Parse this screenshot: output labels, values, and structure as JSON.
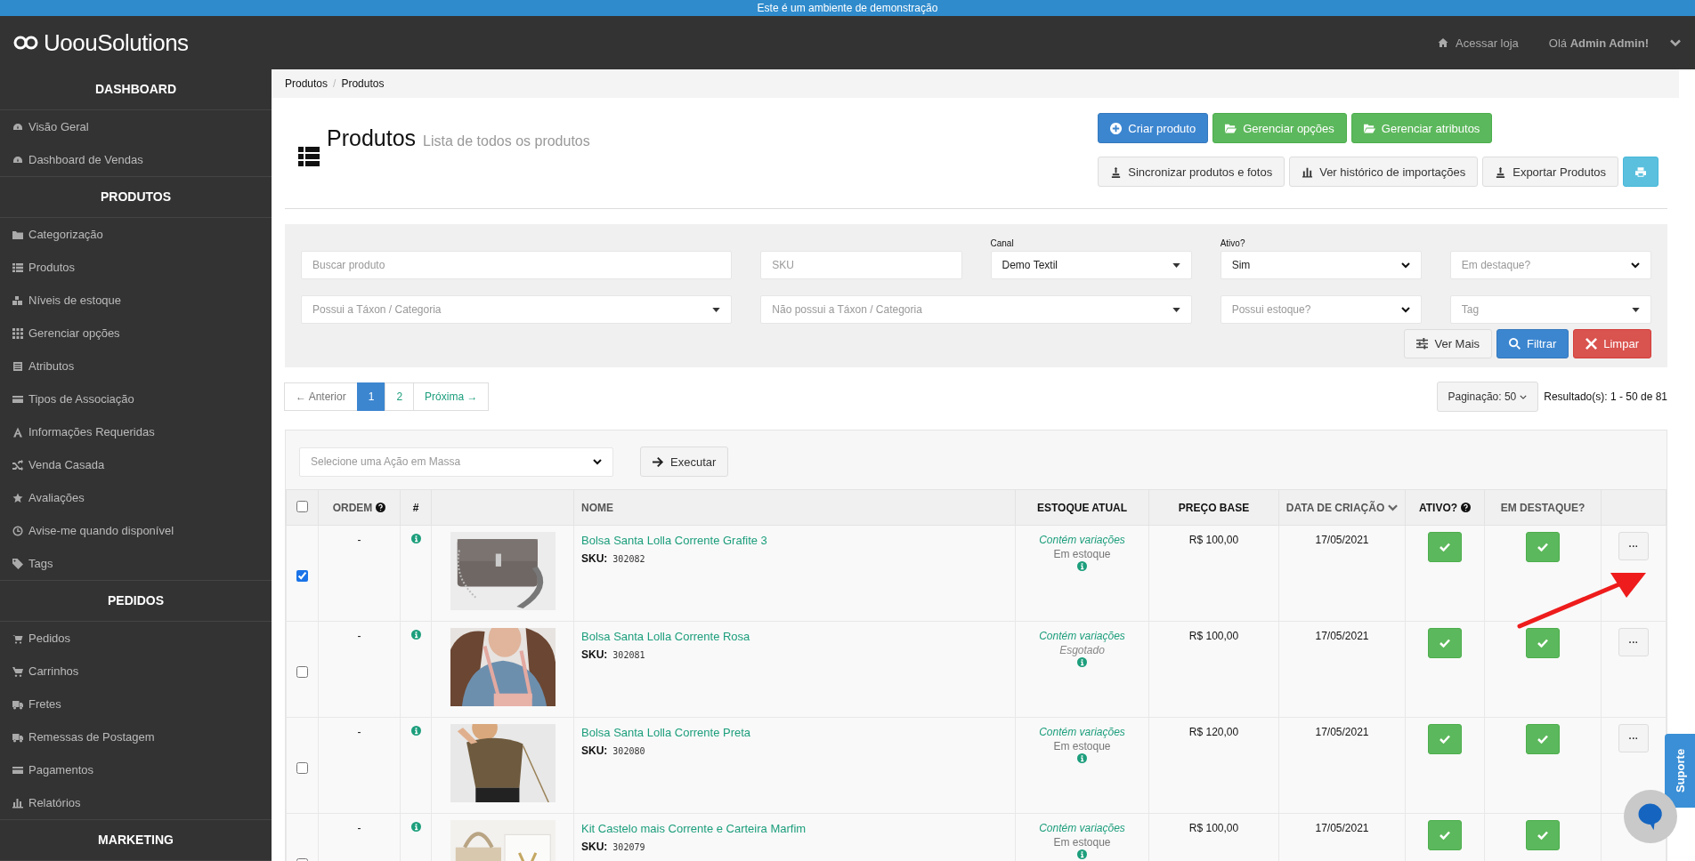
{
  "banner": "Este é um ambiente de demonstração",
  "header": {
    "brand": "**Uoou**Solutions",
    "store_link": "Acessar loja",
    "greeting": "Olá **Admin Admin!**"
  },
  "sidebar": [
    {
      "title": "DASHBOARD",
      "items": [
        "Visão Geral",
        "Dashboard de Vendas"
      ]
    },
    {
      "title": "PRODUTOS",
      "items": [
        "Categorização",
        "Produtos",
        "Níveis de estoque",
        "Gerenciar opções",
        "Atributos",
        "Tipos de Associação",
        "Informações Requeridas",
        "Venda Casada",
        "Avaliações",
        "Avise-me quando disponível",
        "Tags"
      ]
    },
    {
      "title": "PEDIDOS",
      "items": [
        "Pedidos",
        "Carrinhos",
        "Fretes",
        "Remessas de Postagem",
        "Pagamentos",
        "Relatórios"
      ]
    },
    {
      "title": "MARKETING"
    }
  ],
  "breadcrumb": {
    "items": [
      "Produtos",
      "Produtos"
    ],
    "separator": "/"
  },
  "page": {
    "title": "Produtos",
    "subtitle": "Lista de todos os produtos"
  },
  "buttons": [
    [
      {
        "kind": "primary",
        "label": "Criar produto"
      },
      {
        "kind": "success",
        "label": "Gerenciar opções"
      },
      {
        "kind": "success",
        "label": "Gerenciar atributos"
      }
    ],
    [
      {
        "kind": "default",
        "label": "Sincronizar produtos e fotos"
      },
      {
        "kind": "default",
        "label": "Ver histórico de importações"
      },
      {
        "kind": "default",
        "label": "Exportar Produtos"
      },
      {
        "kind": "info"
      }
    ]
  ],
  "filters": [
    [
      {
        "kind": "text",
        "placeholder": "Buscar produto"
      },
      {
        "kind": "text",
        "placeholder": "SKU"
      },
      {
        "kind": "select2",
        "label": "Canal",
        "value": "Demo Textil"
      },
      {
        "kind": "select",
        "label": "Ativo?",
        "value": "Sim"
      },
      {
        "kind": "select",
        "placeholder": "Em destaque?"
      }
    ],
    [
      {
        "kind": "select2",
        "placeholder": "Possui a Táxon / Categoria"
      },
      {
        "kind": "select2",
        "placeholder": "Não possui a Táxon / Categoria"
      },
      {
        "kind": "select",
        "placeholder": "Possui estoque?"
      },
      {
        "kind": "select2",
        "placeholder": "Tag"
      }
    ]
  ],
  "filter_buttons": [
    {
      "kind": "default",
      "label": "Ver Mais"
    },
    {
      "kind": "primary",
      "label": "Filtrar"
    },
    {
      "kind": "danger",
      "label": "Limpar"
    }
  ],
  "pagination": {
    "prev": "← Anterior",
    "next": "Próxima →",
    "pages": [
      {
        "label": "1",
        "selected": true
      },
      {
        "label": "2",
        "selected": false
      }
    ],
    "page_size": "Paginação: 50",
    "results": "Resultado(s): 1 - 50 de 81"
  },
  "bulk": {
    "placeholder": "Selecione uma Ação em Massa",
    "button": "Executar"
  },
  "table": {
    "select_all": {
      "checked": false
    },
    "columns": [
      {
        "label": "ORDEM",
        "sortable": true,
        "help": true,
        "sorted": false
      },
      {
        "label": "#",
        "sortable": false,
        "help": false,
        "sorted": false
      },
      {
        "label": "NOME",
        "sortable": true,
        "help": false,
        "sorted": false
      },
      {
        "label": "ESTOQUE ATUAL",
        "sortable": false,
        "help": false,
        "sorted": false
      },
      {
        "label": "PREÇO BASE",
        "sortable": false,
        "help": false,
        "sorted": false
      },
      {
        "label": "DATA DE CRIAÇÃO",
        "sortable": true,
        "help": false,
        "sorted": true
      },
      {
        "label": "ATIVO?",
        "sortable": false,
        "help": true,
        "sorted": false
      },
      {
        "label": "EM DESTAQUE?",
        "sortable": true,
        "help": false,
        "sorted": false
      }
    ],
    "rows": [
      {
        "checked": true,
        "order": "-",
        "name": "Bolsa Santa Lolla Corrente Grafite 3",
        "sku_label": "SKU:",
        "sku": "302082",
        "variants": "Contém variações",
        "stock": "Em estoque",
        "in_stock": true,
        "price": "R$ 100,00",
        "created": "17/05/2021",
        "active": true,
        "featured": true,
        "more": "···"
      },
      {
        "checked": false,
        "order": "-",
        "name": "Bolsa Santa Lolla Corrente Rosa",
        "sku_label": "SKU:",
        "sku": "302081",
        "variants": "Contém variações",
        "stock": "Esgotado",
        "in_stock": false,
        "price": "R$ 100,00",
        "created": "17/05/2021",
        "active": true,
        "featured": true,
        "more": "···"
      },
      {
        "checked": false,
        "order": "-",
        "name": "Bolsa Santa Lolla Corrente Preta",
        "sku_label": "SKU:",
        "sku": "302080",
        "variants": "Contém variações",
        "stock": "Em estoque",
        "in_stock": true,
        "price": "R$ 120,00",
        "created": "17/05/2021",
        "active": true,
        "featured": true,
        "more": "···"
      },
      {
        "checked": false,
        "order": "-",
        "name": "Kit Castelo mais Corrente e Carteira Marfim",
        "sku_label": "SKU:",
        "sku": "302079",
        "variants": "Contém variações",
        "stock": "Em estoque",
        "in_stock": true,
        "price": "R$ 100,00",
        "created": "17/05/2021",
        "active": true,
        "featured": true
      }
    ]
  },
  "support": "Suporte"
}
